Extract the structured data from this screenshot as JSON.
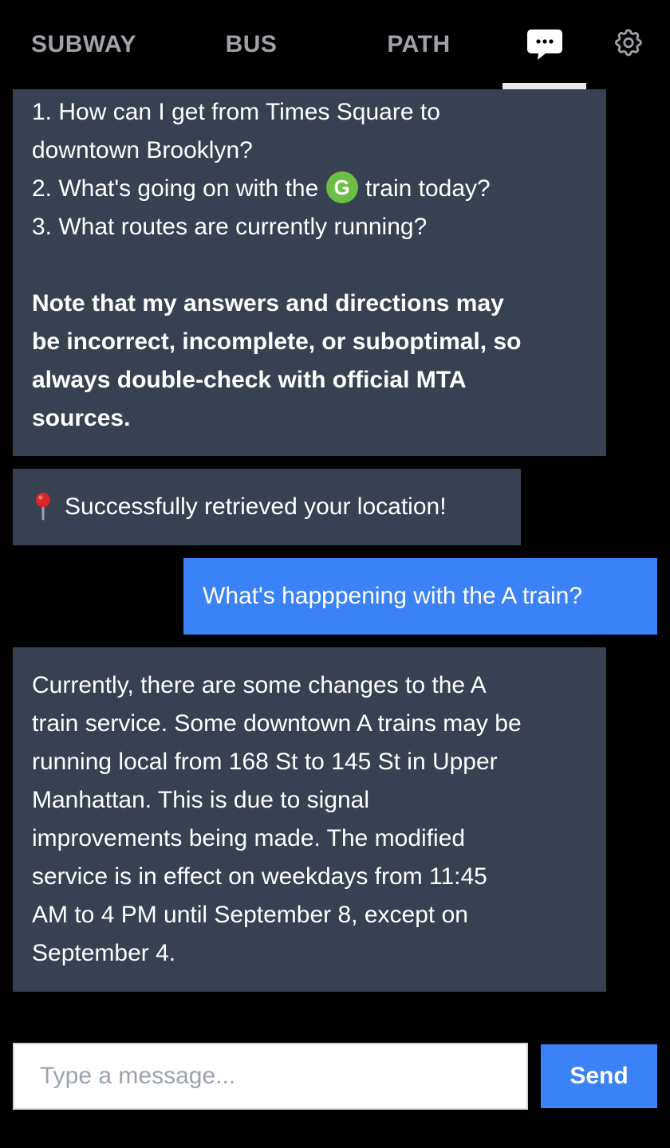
{
  "nav": {
    "tabs": [
      {
        "label": "SUBWAY"
      },
      {
        "label": "BUS"
      },
      {
        "label": "PATH"
      }
    ],
    "chat_icon": "chat-bubble-icon",
    "settings_icon": "gear-icon",
    "active_tab": "chat"
  },
  "messages": {
    "welcome": {
      "items": [
        "1. How can I get from Times Square to",
        "downtown Brooklyn?",
        "2. What's going on with the",
        "train today?",
        "3. What routes are currently running?"
      ],
      "route_bullet": "G",
      "note_lines": [
        "Note that my answers and directions may",
        "be incorrect, incomplete, or suboptimal, so",
        "always double-check with official MTA",
        "sources."
      ]
    },
    "location": {
      "icon": "pushpin-icon",
      "text": "Successfully retrieved your location!"
    },
    "user": {
      "text": "What's happpening with the A train?"
    },
    "reply": {
      "lines": [
        "Currently, there are some changes to the A",
        "train service. Some downtown A trains may be",
        "running local from 168 St to 145 St in Upper",
        "Manhattan. This is due to signal",
        "improvements being made. The modified",
        "service is in effect on weekdays from 11:45",
        "AM to 4 PM until September 8, except on",
        "September 4."
      ]
    }
  },
  "composer": {
    "placeholder": "Type a message...",
    "value": "",
    "send_label": "Send"
  },
  "colors": {
    "background": "#000000",
    "bot_bubble": "#374151",
    "user_bubble": "#3b82f6",
    "send_button": "#3b82f6",
    "g_train": "#6cbe45",
    "inactive_tab_text": "#a1a1aa"
  }
}
